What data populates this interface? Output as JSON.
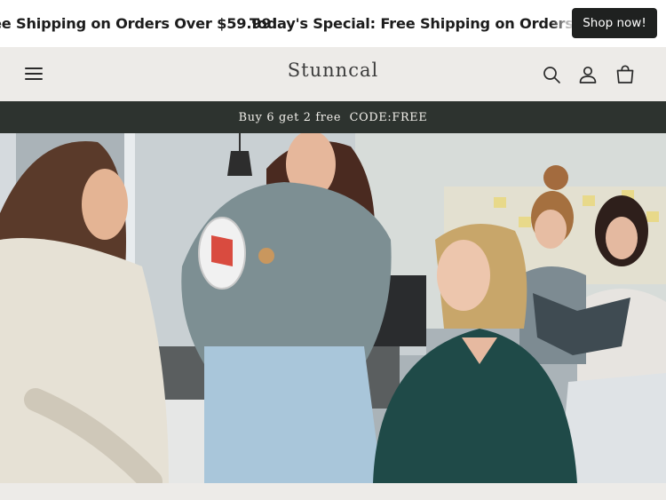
{
  "announcement_marquee": {
    "items": [
      "ee Shipping on Orders Over $59.99!",
      "Today's Special: Free Shipping on Orders Ove"
    ],
    "cta_label": "Shop now!"
  },
  "header": {
    "logo": "Stunncal",
    "icons": {
      "menu": "hamburger-menu-icon",
      "search": "search-icon",
      "account": "account-icon",
      "cart": "cart-icon"
    }
  },
  "promo_bar": {
    "text": "Buy 6 get 2 free  CODE:FREE"
  },
  "hero": {
    "image_subject": "women in a kitchen looking at a kitchen gadget"
  },
  "colors": {
    "header_bg": "#edebe8",
    "promo_bg": "#2d332f",
    "button_bg": "#1f2120"
  }
}
